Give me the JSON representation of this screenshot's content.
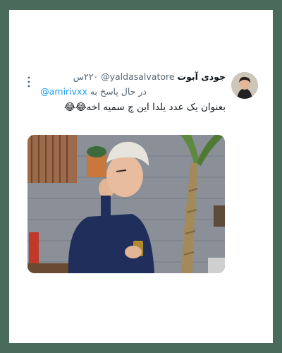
{
  "tweet": {
    "display_name": "جودی آبوت",
    "handle": "@yaldasalvatore",
    "time": "۲۲۰س",
    "reply_prefix": "در حال پاسخ به",
    "reply_handle": "@amirivxx",
    "text": "بعنوان یک عدد یلدا این چ سمیه اخه😂😂"
  },
  "icons": {
    "more": "more-vertical-icon"
  },
  "colors": {
    "frame": "#4a6b5c",
    "card": "#ffffff",
    "link": "#1d9bf0",
    "secondary_text": "#536471",
    "primary_text": "#0f1419"
  }
}
